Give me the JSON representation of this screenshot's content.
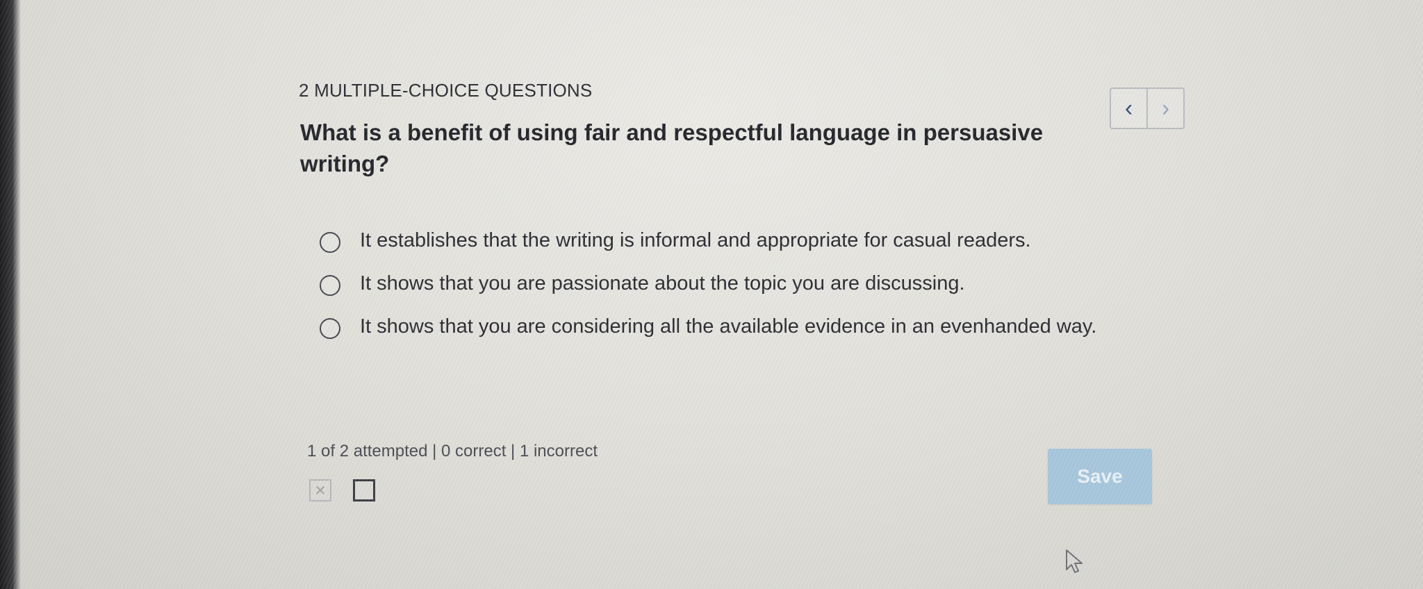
{
  "section": {
    "label": "2 MULTIPLE-CHOICE QUESTIONS"
  },
  "nav": {
    "prev_icon": "chevron-left-icon",
    "next_icon": "chevron-right-icon",
    "prev_glyph": "‹",
    "next_glyph": "›"
  },
  "question": {
    "text": "What is a benefit of using fair and respectful language in persuasive writing?"
  },
  "options": [
    {
      "label": "It establishes that the writing is informal and appropriate for casual readers.",
      "selected": false
    },
    {
      "label": "It shows that you are passionate about the topic you are discussing.",
      "selected": false
    },
    {
      "label": "It shows that you are considering all the available evidence in an evenhanded way.",
      "selected": false
    }
  ],
  "status": {
    "text": "1 of 2 attempted | 0 correct | 1 incorrect"
  },
  "progress_markers": [
    {
      "state": "incorrect",
      "glyph": "✕"
    },
    {
      "state": "unanswered",
      "glyph": ""
    }
  ],
  "save": {
    "label": "Save",
    "enabled": false
  },
  "colors": {
    "save_button": "#a7c7dc",
    "nav_active": "#35507a",
    "nav_inactive": "#9aa8bd"
  }
}
